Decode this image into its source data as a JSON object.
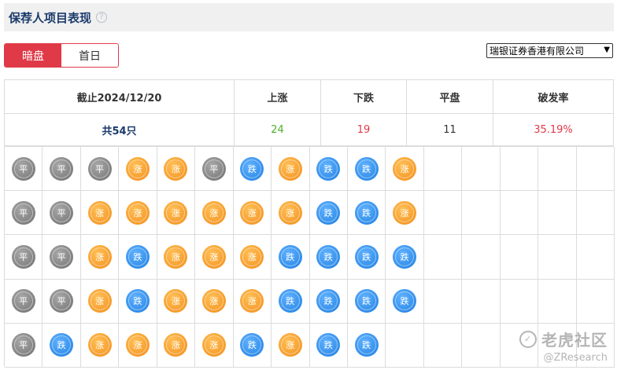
{
  "header": {
    "title": "保荐人项目表现",
    "help_icon": "question-circle-icon"
  },
  "toggle": {
    "active_label": "暗盘",
    "inactive_label": "首日"
  },
  "sponsor_select": {
    "selected": "瑞银证券香港有限公司"
  },
  "summary": {
    "headers": [
      "截止2024/12/20",
      "上涨",
      "下跌",
      "平盘",
      "破发率"
    ],
    "total_label": "共54只",
    "up_count": "24",
    "down_count": "19",
    "flat_count": "11",
    "break_rate": "35.19%"
  },
  "ball_labels": {
    "flat": "平",
    "up": "涨",
    "down": "跌"
  },
  "colors": {
    "accent": "#e03a48",
    "up": "#4caf2a",
    "down": "#e03a48",
    "ball_up": "#f28d1a",
    "ball_down": "#1f7fe0",
    "ball_flat": "#7a7a7a"
  },
  "grid_columns": 16,
  "grid_rows": [
    [
      "flat",
      "flat",
      "flat",
      "up",
      "up",
      "flat",
      "down",
      "up",
      "down",
      "down",
      "up"
    ],
    [
      "flat",
      "flat",
      "up",
      "up",
      "up",
      "up",
      "up",
      "up",
      "down",
      "down",
      "up"
    ],
    [
      "flat",
      "flat",
      "up",
      "down",
      "up",
      "up",
      "up",
      "down",
      "down",
      "down",
      "down"
    ],
    [
      "flat",
      "flat",
      "up",
      "down",
      "up",
      "up",
      "up",
      "down",
      "down",
      "down",
      "down"
    ],
    [
      "flat",
      "down",
      "up",
      "up",
      "up",
      "up",
      "down",
      "up",
      "down",
      "down"
    ]
  ],
  "watermark": {
    "main": "老虎社区",
    "sub": "@ZResearch",
    "logo_char": "✓"
  }
}
